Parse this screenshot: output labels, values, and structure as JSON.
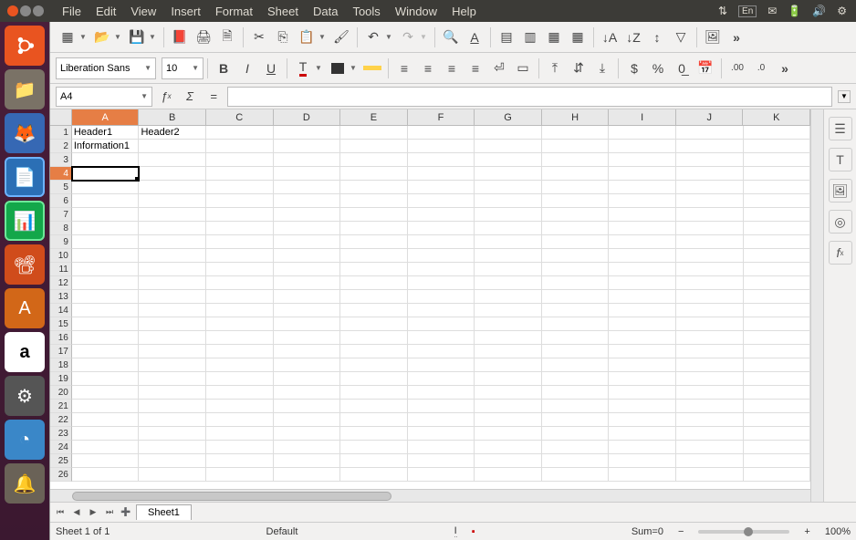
{
  "menubar": [
    "File",
    "Edit",
    "View",
    "Insert",
    "Format",
    "Sheet",
    "Data",
    "Tools",
    "Window",
    "Help"
  ],
  "sys_lang": "En",
  "toolbar2": {
    "font_name": "Liberation Sans",
    "font_size": "10"
  },
  "formula": {
    "cell_ref": "A4",
    "value": ""
  },
  "columns": [
    "A",
    "B",
    "C",
    "D",
    "E",
    "F",
    "G",
    "H",
    "I",
    "J",
    "K"
  ],
  "selected_col": "A",
  "selected_row": 4,
  "cells": {
    "A1": "Header1",
    "B1": "Header2",
    "A2": "Information1"
  },
  "num_rows": 26,
  "sheet_tabs": [
    "Sheet1"
  ],
  "statusbar": {
    "sheet_info": "Sheet 1 of 1",
    "style": "Default",
    "insert_mode": "I",
    "sum": "Sum=0",
    "zoom": "100%"
  }
}
